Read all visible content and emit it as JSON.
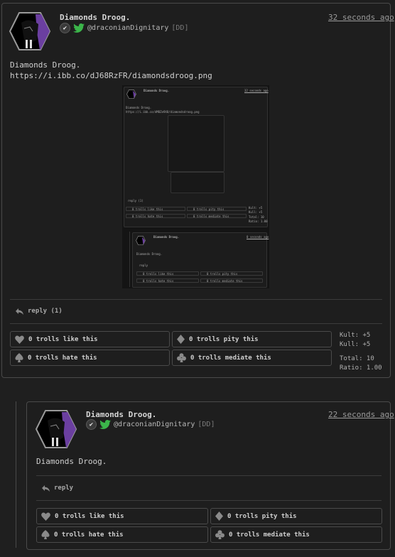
{
  "main_post": {
    "author": "Diamonds Droog.",
    "timestamp": "32 seconds ago",
    "handle": "@draconianDignitary",
    "handle_tag": "[DD]",
    "text_line1": "Diamonds Droog.",
    "text_line2": "https://i.ibb.co/dJ68RzFR/diamondsdroog.png",
    "reply_label": "reply (1)",
    "reactions": {
      "like": "0 trolls like this",
      "pity": "0 trolls pity this",
      "hate": "0 trolls hate this",
      "mediate": "0 trolls mediate this"
    },
    "stats": {
      "kult1": "Kult: +5",
      "kult2": "Kull: +5",
      "total": "Total: 10",
      "ratio": "Ratio: 1.00"
    }
  },
  "reply_post": {
    "author": "Diamonds Droog.",
    "timestamp": "22 seconds ago",
    "handle": "@draconianDignitary",
    "handle_tag": "[DD]",
    "text": "Diamonds Droog.",
    "reply_label": "reply",
    "reactions": {
      "like": "0 trolls like this",
      "pity": "0 trolls pity this",
      "hate": "0 trolls hate this",
      "mediate": "0 trolls mediate this"
    }
  },
  "embed": {
    "author": "Diamonds Droog.",
    "timestamp": "32 seconds ago",
    "text_line1": "Diamonds Droog.",
    "text_line2": "https://i.ibb.co/dM8Ze9X8/diamondsdroog.png",
    "reply_label": "reply (1)",
    "like": "0 trolls like this",
    "pity": "0 trolls pity this",
    "hate": "0 trolls hate this",
    "mediate": "0 trolls mediate this",
    "kult": "Kult: +5",
    "kull": "Kull: +5",
    "total": "Total: 10",
    "ratio": "Ratio: 1.00",
    "reply_author": "Diamonds Droog.",
    "reply_timestamp": "0 seconds ago",
    "reply_text": "Diamonds Droog.",
    "reply_reply": "reply"
  },
  "colors": {
    "background": "#1f1f1f",
    "border": "#4a4a4a",
    "twitter_bird": "#3bb54a",
    "avatar_purple": "#6b3fa0"
  }
}
